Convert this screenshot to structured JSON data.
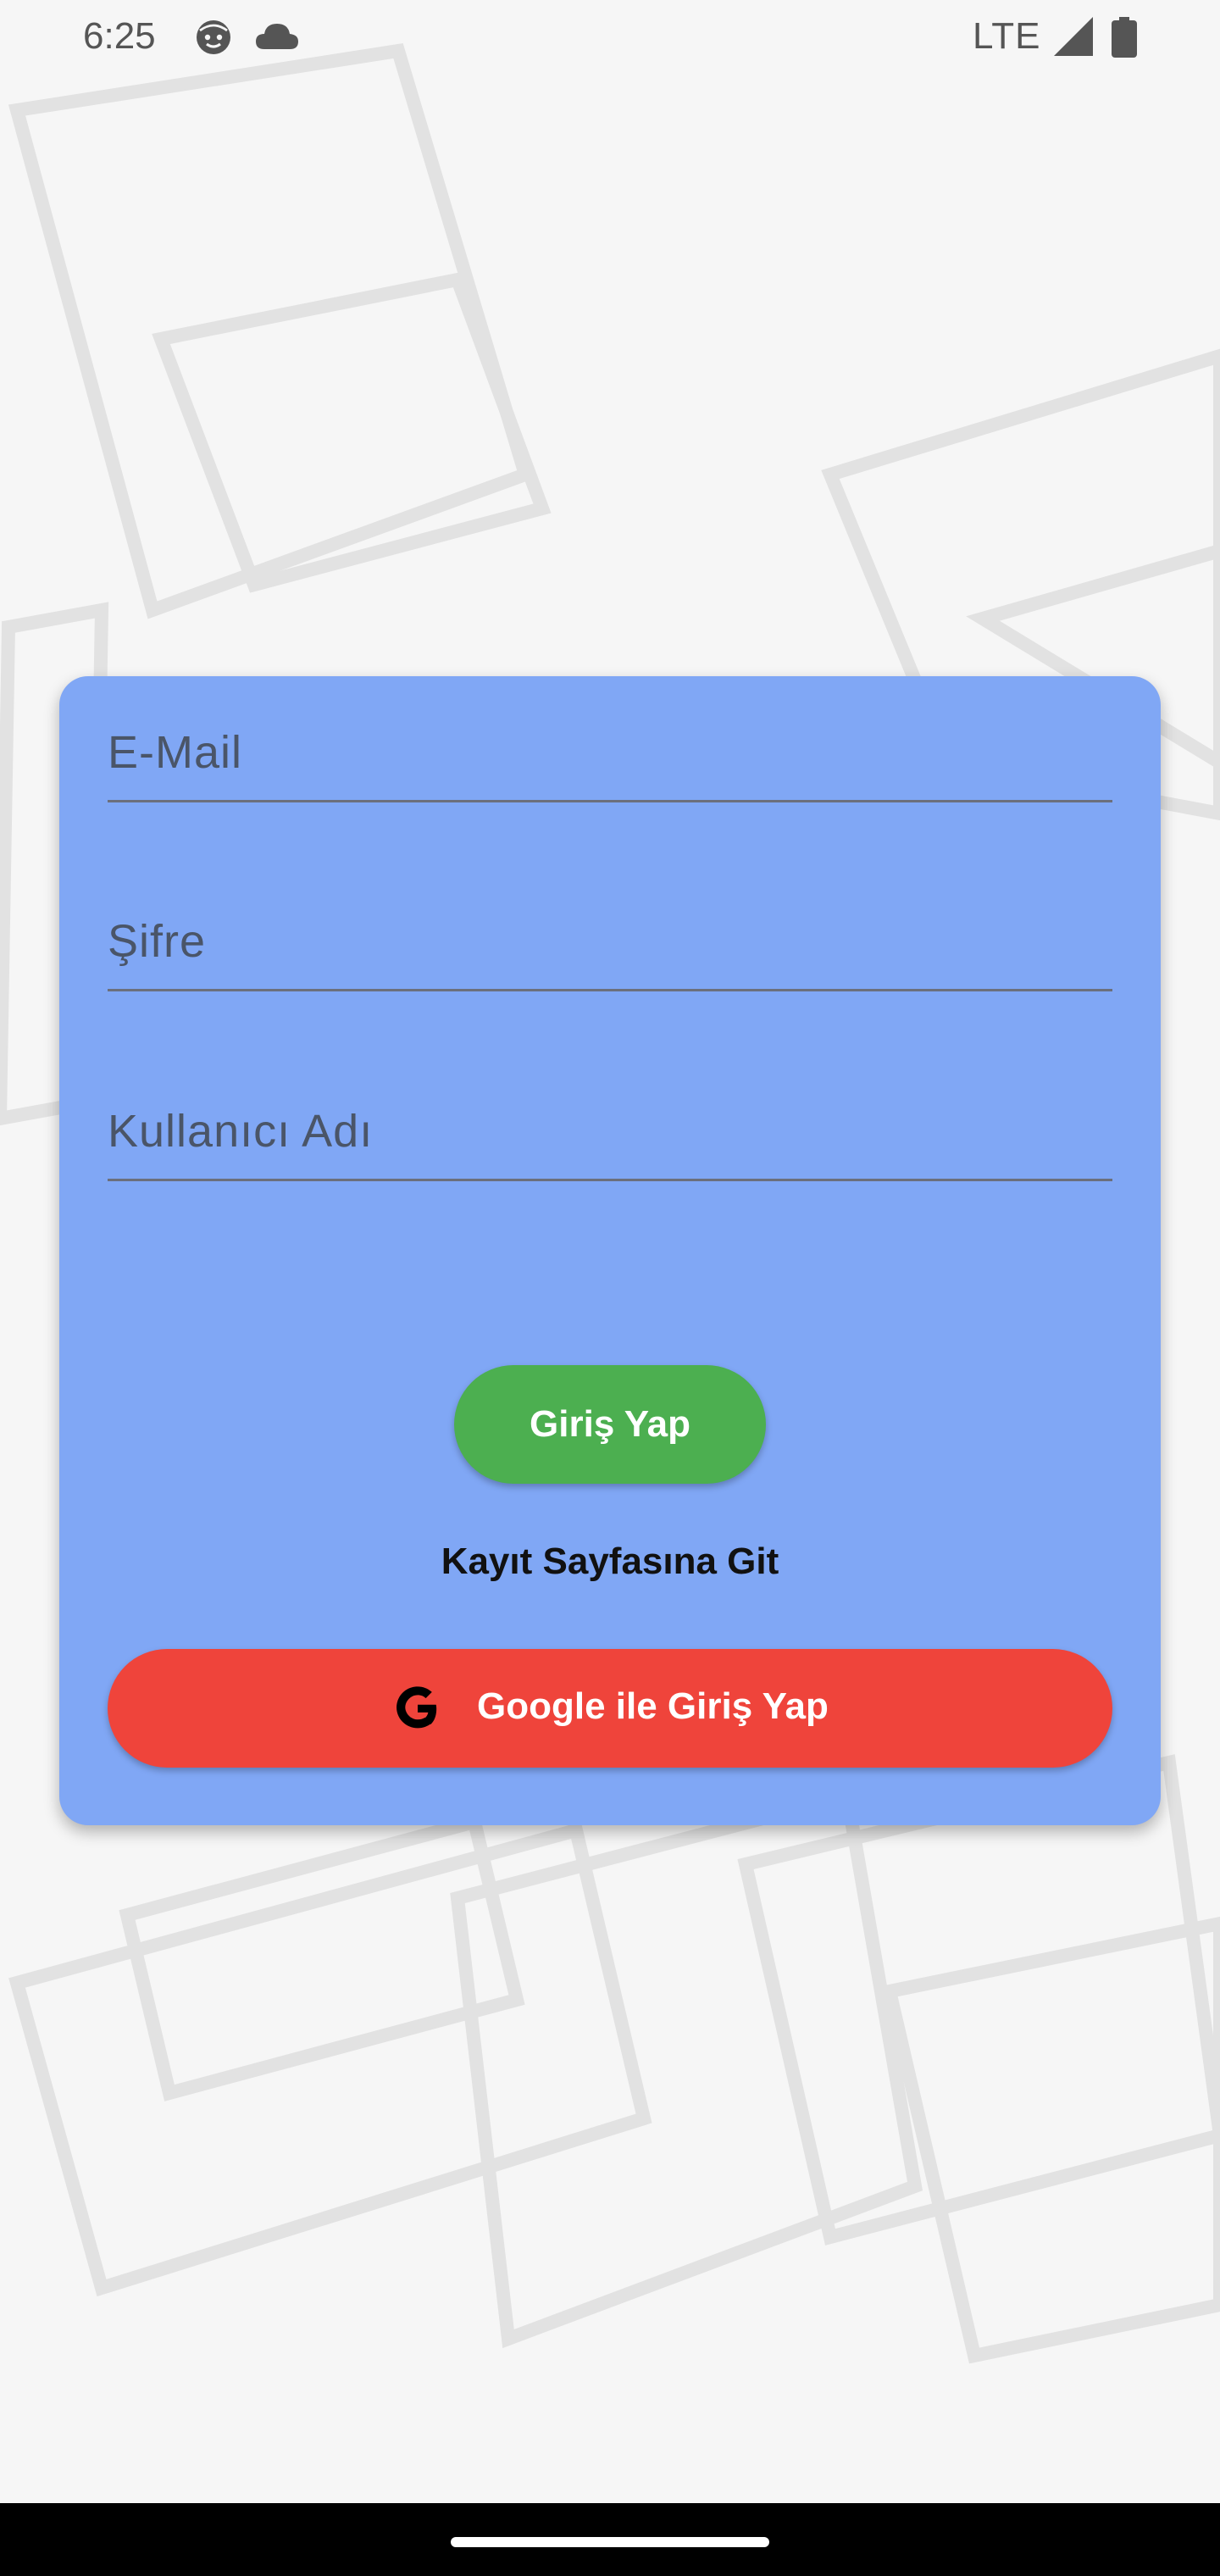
{
  "status_bar": {
    "time": "6:25",
    "network": "LTE",
    "icons": [
      "face-notification-icon",
      "cloud-icon",
      "signal-icon",
      "battery-icon"
    ]
  },
  "login_form": {
    "email_placeholder": "E-Mail",
    "password_placeholder": "Şifre",
    "username_placeholder": "Kullanıcı Adı",
    "login_button": "Giriş Yap",
    "register_link": "Kayıt Sayfasına Git",
    "google_button": "Google ile Giriş Yap"
  },
  "colors": {
    "card": "#80a7f5",
    "login_button": "#4caf50",
    "google_button": "#ef443b"
  }
}
